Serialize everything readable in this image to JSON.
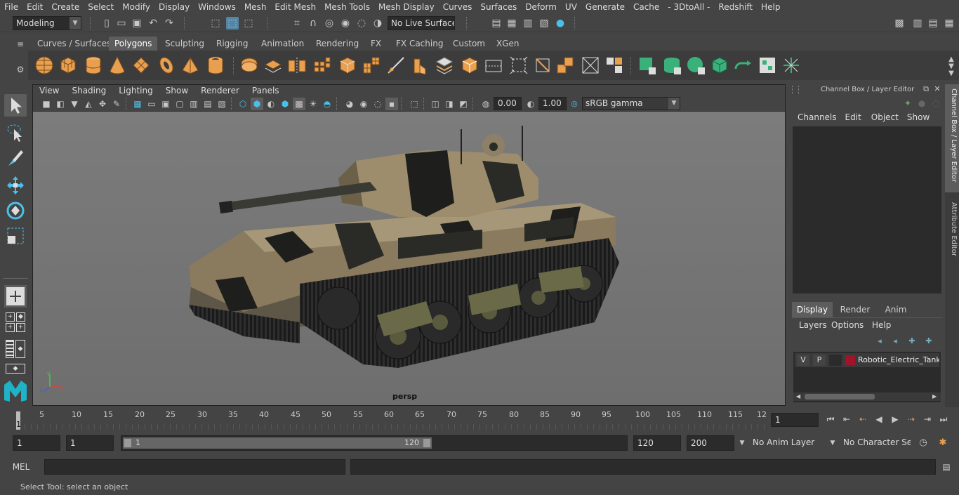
{
  "menubar": {
    "items": [
      "File",
      "Edit",
      "Create",
      "Select",
      "Modify",
      "Display",
      "Windows",
      "Mesh",
      "Edit Mesh",
      "Mesh Tools",
      "Mesh Display",
      "Curves",
      "Surfaces",
      "Deform",
      "UV",
      "Generate",
      "Cache",
      "- 3DtoAll -",
      "Redshift",
      "Help"
    ]
  },
  "statusline": {
    "mode": "Modeling",
    "live_surface": "No Live Surface"
  },
  "shelf": {
    "tabs": [
      "Curves / Surfaces",
      "Polygons",
      "Sculpting",
      "Rigging",
      "Animation",
      "Rendering",
      "FX",
      "FX Caching",
      "Custom",
      "XGen"
    ],
    "active_tab": "Polygons"
  },
  "panel": {
    "menu": [
      "View",
      "Shading",
      "Lighting",
      "Show",
      "Renderer",
      "Panels"
    ],
    "exposure": "0.00",
    "gamma": "1.00",
    "colorspace": "sRGB gamma",
    "camera_label": "persp"
  },
  "channelbox": {
    "title": "Channel Box / Layer Editor",
    "menu": [
      "Channels",
      "Edit",
      "Object",
      "Show"
    ],
    "layer_tabs": [
      "Display",
      "Render",
      "Anim"
    ],
    "active_layer_tab": "Display",
    "layer_menu": [
      "Layers",
      "Options",
      "Help"
    ],
    "layer": {
      "v": "V",
      "p": "P",
      "name": "Robotic_Electric_Tank_",
      "color": "#a0142a"
    }
  },
  "sidetabs": [
    "Channel Box / Layer Editor",
    "Attribute Editor"
  ],
  "timeline": {
    "ticks": [
      "5",
      "10",
      "15",
      "20",
      "25",
      "30",
      "35",
      "40",
      "45",
      "50",
      "55",
      "60",
      "65",
      "70",
      "75",
      "80",
      "85",
      "90",
      "95",
      "100",
      "105",
      "110",
      "115",
      "12"
    ],
    "start_marker": "1",
    "current_frame": "1"
  },
  "range": {
    "start": "1",
    "playback_start": "1",
    "slider_start": "1",
    "slider_end": "120",
    "playback_end": "120",
    "end": "200",
    "anim_layer": "No Anim Layer",
    "char_set": "No Character Set"
  },
  "cmdline": {
    "label": "MEL"
  },
  "helpline": {
    "text": "Select Tool: select an object"
  },
  "colors": {
    "accent": "#5285a6",
    "shelf_orange": "#e8a050",
    "shelf_green": "#3ab07a"
  }
}
